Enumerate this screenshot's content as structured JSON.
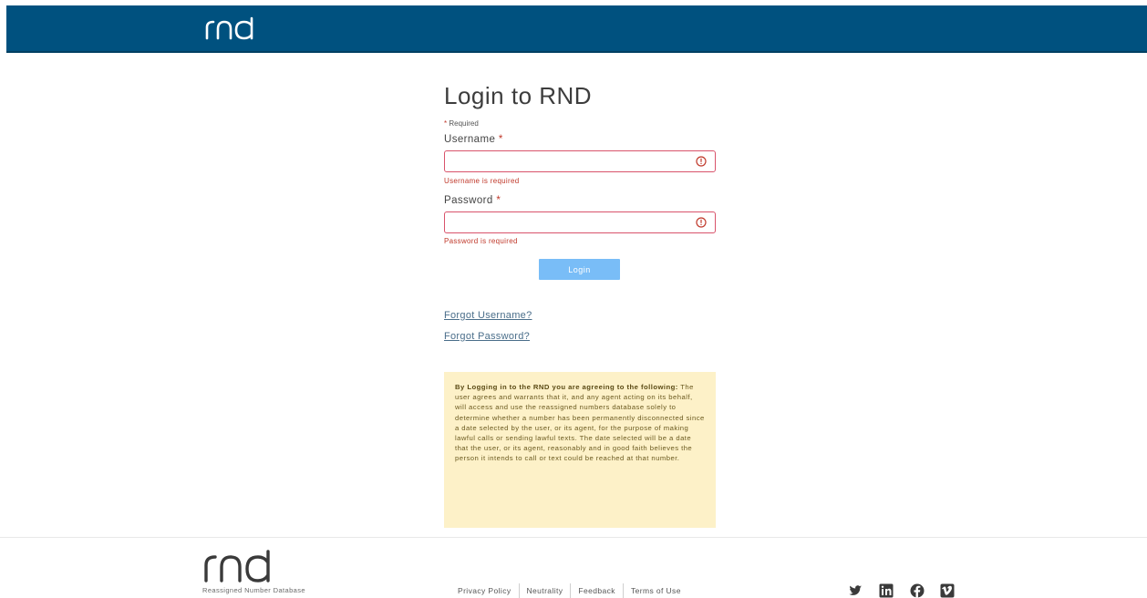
{
  "header": {
    "logo_text": "rnd"
  },
  "login": {
    "title": "Login to RND",
    "required_note": "Required",
    "required_star": "*",
    "username_label": "Username",
    "username_value": "",
    "username_error": "Username is required",
    "password_label": "Password",
    "password_value": "",
    "password_error": "Password is required",
    "submit_label": "Login",
    "forgot_username": "Forgot Username?",
    "forgot_password": "Forgot Password?"
  },
  "agreement": {
    "lead": "By Logging in to the RND you are agreeing to the following:",
    "body": "The user agrees and warrants that it, and any agent acting on its behalf, will access and use the reassigned numbers database solely to determine whether a number has been permanently disconnected since a date selected by the user, or its agent, for the purpose of making lawful calls or sending lawful texts. The date selected will be a date that the user, or its agent, reasonably and in good faith believes the person it intends to call or text could be reached at that number."
  },
  "footer": {
    "logo_text": "rnd",
    "tagline": "Reassigned Number Database",
    "links": [
      "Privacy Policy",
      "Neutrality",
      "Feedback",
      "Terms of Use"
    ],
    "social": [
      "twitter-icon",
      "linkedin-icon",
      "facebook-icon",
      "vimeo-icon"
    ]
  },
  "colors": {
    "header_bg": "#00517f",
    "error": "#d9536b",
    "button_bg": "#79bdf7",
    "agreement_bg": "#fdf1c8"
  }
}
